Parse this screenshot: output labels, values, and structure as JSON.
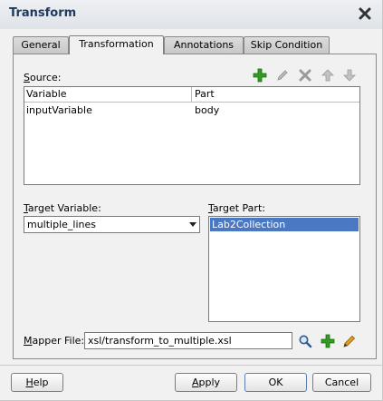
{
  "dialog": {
    "title": "Transform"
  },
  "tabs": [
    {
      "label": "General"
    },
    {
      "label": "Transformation"
    },
    {
      "label": "Annotations"
    },
    {
      "label": "Skip Condition"
    }
  ],
  "source": {
    "label_mnemonic": "S",
    "label_rest": "ource:",
    "columns": [
      "Variable",
      "Part"
    ],
    "rows": [
      {
        "variable": "inputVariable",
        "part": "body"
      }
    ]
  },
  "toolbar_icons": [
    "add-icon",
    "edit-icon",
    "delete-icon",
    "move-up-icon",
    "move-down-icon"
  ],
  "target_variable": {
    "label_mnemonic": "T",
    "label_rest": "arget Variable:",
    "selected": "multiple_lines"
  },
  "target_part": {
    "label_mnemonic": "T",
    "label_rest": "arget Part:",
    "items": [
      "Lab2Collection"
    ]
  },
  "mapper_file": {
    "label_mnemonic": "M",
    "label_rest": "apper File:",
    "value": "xsl/transform_to_multiple.xsl"
  },
  "buttons": {
    "help_mnemonic": "H",
    "help_rest": "elp",
    "apply_mnemonic": "A",
    "apply_rest": "pply",
    "ok": "OK",
    "cancel": "Cancel"
  },
  "colors": {
    "title": "#1d3a5f",
    "selection": "#4a78c2",
    "add_green": "#2e9e1e",
    "pencil": "#c98a12"
  }
}
